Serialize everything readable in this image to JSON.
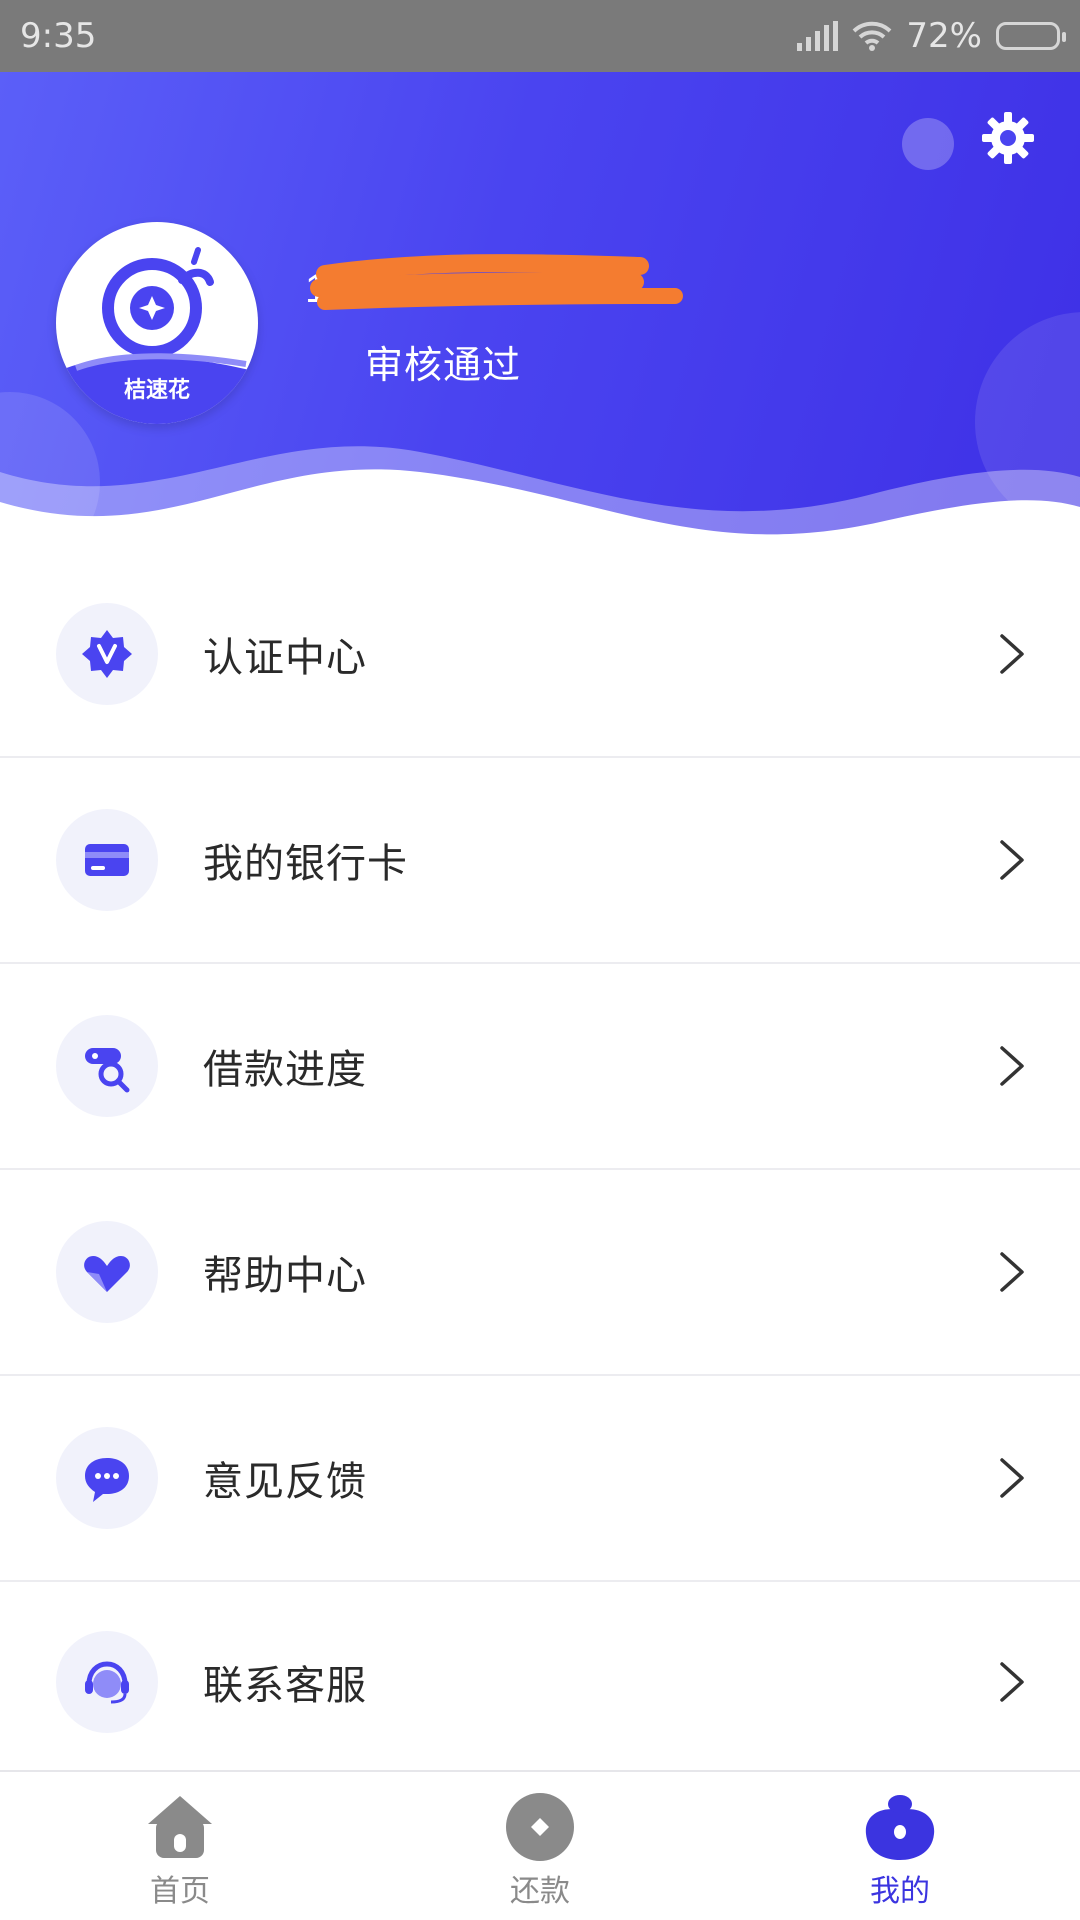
{
  "status_bar": {
    "time": "9:35",
    "battery": "72%",
    "battery_level": 0.72
  },
  "header": {
    "avatar_brand": "桔速花",
    "username": "[redacted]",
    "status": "审核通过",
    "settings_icon": "gear-icon"
  },
  "menu": {
    "items": [
      {
        "label": "认证中心",
        "icon": "verified-badge-icon"
      },
      {
        "label": "我的银行卡",
        "icon": "bank-card-icon"
      },
      {
        "label": "借款进度",
        "icon": "search-progress-icon"
      },
      {
        "label": "帮助中心",
        "icon": "heart-hands-icon"
      },
      {
        "label": "意见反馈",
        "icon": "chat-bubble-icon"
      },
      {
        "label": "联系客服",
        "icon": "headset-icon"
      }
    ]
  },
  "bottom_nav": {
    "items": [
      {
        "label": "首页",
        "icon": "home-icon",
        "active": false
      },
      {
        "label": "还款",
        "icon": "repay-icon",
        "active": false
      },
      {
        "label": "我的",
        "icon": "profile-icon",
        "active": true
      }
    ]
  },
  "colors": {
    "brand": "#4a44f0",
    "brand_dark": "#3e30e6",
    "active_nav": "#3b34e0",
    "inactive_nav": "#8a8a8a",
    "redaction": "#f47c30"
  }
}
